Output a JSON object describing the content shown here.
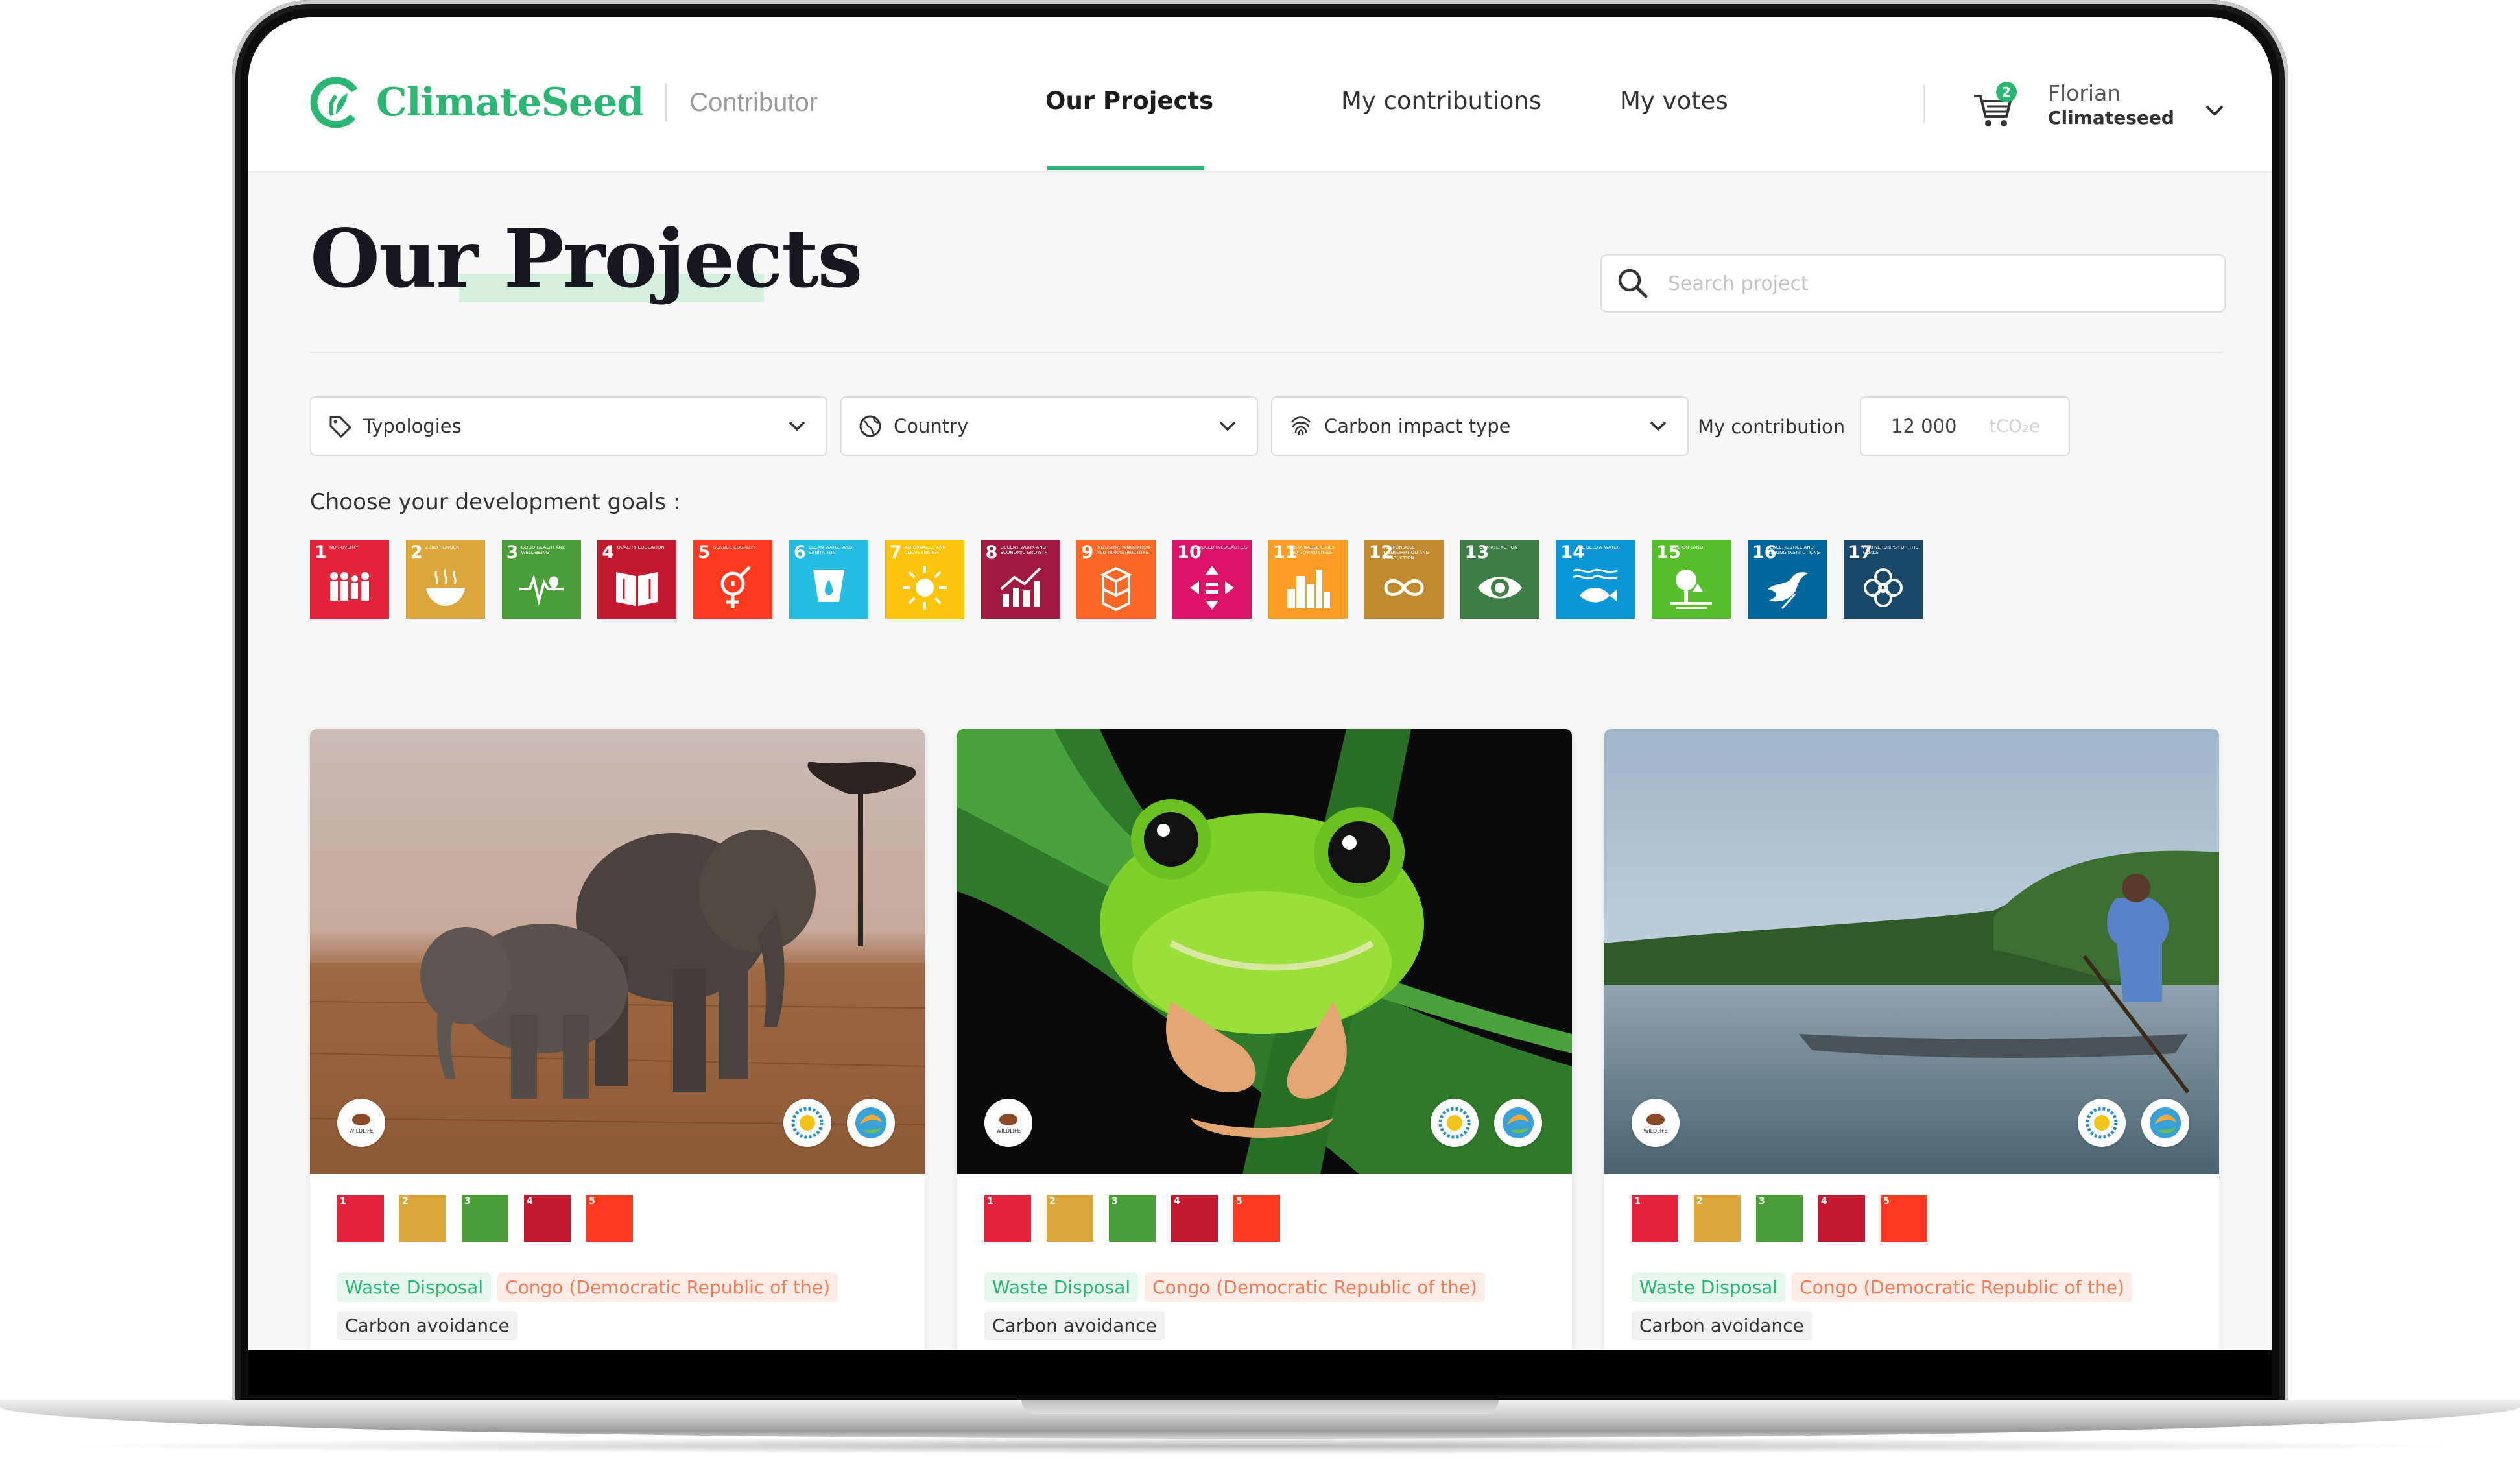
{
  "app": {
    "brand": "ClimateSeed",
    "role": "Contributor"
  },
  "nav": {
    "items": [
      {
        "label": "Our Projects",
        "active": true
      },
      {
        "label": "My contributions",
        "active": false
      },
      {
        "label": "My votes",
        "active": false
      }
    ],
    "cart_count": "2",
    "user": {
      "name": "Florian",
      "company": "Climateseed"
    }
  },
  "page": {
    "title": "Our Projects",
    "search_placeholder": "Search project"
  },
  "filters": {
    "typologies": "Typologies",
    "country": "Country",
    "carbon_impact": "Carbon impact type",
    "contribution_label": "My contribution",
    "contribution_value": "12 000",
    "contribution_unit": "tCO₂e"
  },
  "goals": {
    "label": "Choose your development goals :",
    "items": [
      {
        "num": "1",
        "text": "No poverty",
        "color": "#e5243b",
        "icon": "family-icon"
      },
      {
        "num": "2",
        "text": "Zero hunger",
        "color": "#dda63a",
        "icon": "bowl-icon"
      },
      {
        "num": "3",
        "text": "Good health and well-being",
        "color": "#4c9f38",
        "icon": "heartbeat-icon"
      },
      {
        "num": "4",
        "text": "Quality education",
        "color": "#c5192d",
        "icon": "book-icon"
      },
      {
        "num": "5",
        "text": "Gender equality",
        "color": "#ff3a21",
        "icon": "gender-icon"
      },
      {
        "num": "6",
        "text": "Clean water and sanitation",
        "color": "#26bde2",
        "icon": "water-icon"
      },
      {
        "num": "7",
        "text": "Affordable and clean energy",
        "color": "#fcc30b",
        "icon": "sun-icon"
      },
      {
        "num": "8",
        "text": "Decent work and economic growth",
        "color": "#a21942",
        "icon": "growth-chart-icon"
      },
      {
        "num": "9",
        "text": "Industry, innovation and infrastructure",
        "color": "#fd6925",
        "icon": "cubes-icon"
      },
      {
        "num": "10",
        "text": "Reduced inequalities",
        "color": "#dd1367",
        "icon": "equality-icon"
      },
      {
        "num": "11",
        "text": "Sustainable cities and communities",
        "color": "#fd9d24",
        "icon": "city-icon"
      },
      {
        "num": "12",
        "text": "Responsible consumption and production",
        "color": "#bf8b2e",
        "icon": "infinity-icon"
      },
      {
        "num": "13",
        "text": "Climate action",
        "color": "#3f7e44",
        "icon": "eye-globe-icon"
      },
      {
        "num": "14",
        "text": "Life below water",
        "color": "#0a97d9",
        "icon": "fish-icon"
      },
      {
        "num": "15",
        "text": "Life on land",
        "color": "#56c02b",
        "icon": "tree-icon"
      },
      {
        "num": "16",
        "text": "Peace, justice and strong institutions",
        "color": "#00689d",
        "icon": "dove-icon"
      },
      {
        "num": "17",
        "text": "Partnerships for the goals",
        "color": "#19486a",
        "icon": "flower-icon"
      }
    ]
  },
  "projects": [
    {
      "image": "elephants",
      "tags": {
        "typology": "Waste Disposal",
        "country": "Congo (Democratic Republic of the)",
        "impact": "Carbon avoidance"
      },
      "sdgs": [
        "1",
        "2",
        "3",
        "4",
        "5"
      ]
    },
    {
      "image": "frog",
      "tags": {
        "typology": "Waste Disposal",
        "country": "Congo (Democratic Republic of the)",
        "impact": "Carbon avoidance"
      },
      "sdgs": [
        "1",
        "2",
        "3",
        "4",
        "5"
      ]
    },
    {
      "image": "river",
      "tags": {
        "typology": "Waste Disposal",
        "country": "Congo (Democratic Republic of the)",
        "impact": "Carbon avoidance"
      },
      "sdgs": [
        "1",
        "2",
        "3",
        "4",
        "5"
      ]
    }
  ],
  "colors": {
    "brand": "#2bb673",
    "tag_green_bg": "#e6f6ec",
    "tag_orange": "#ef7d5a"
  }
}
